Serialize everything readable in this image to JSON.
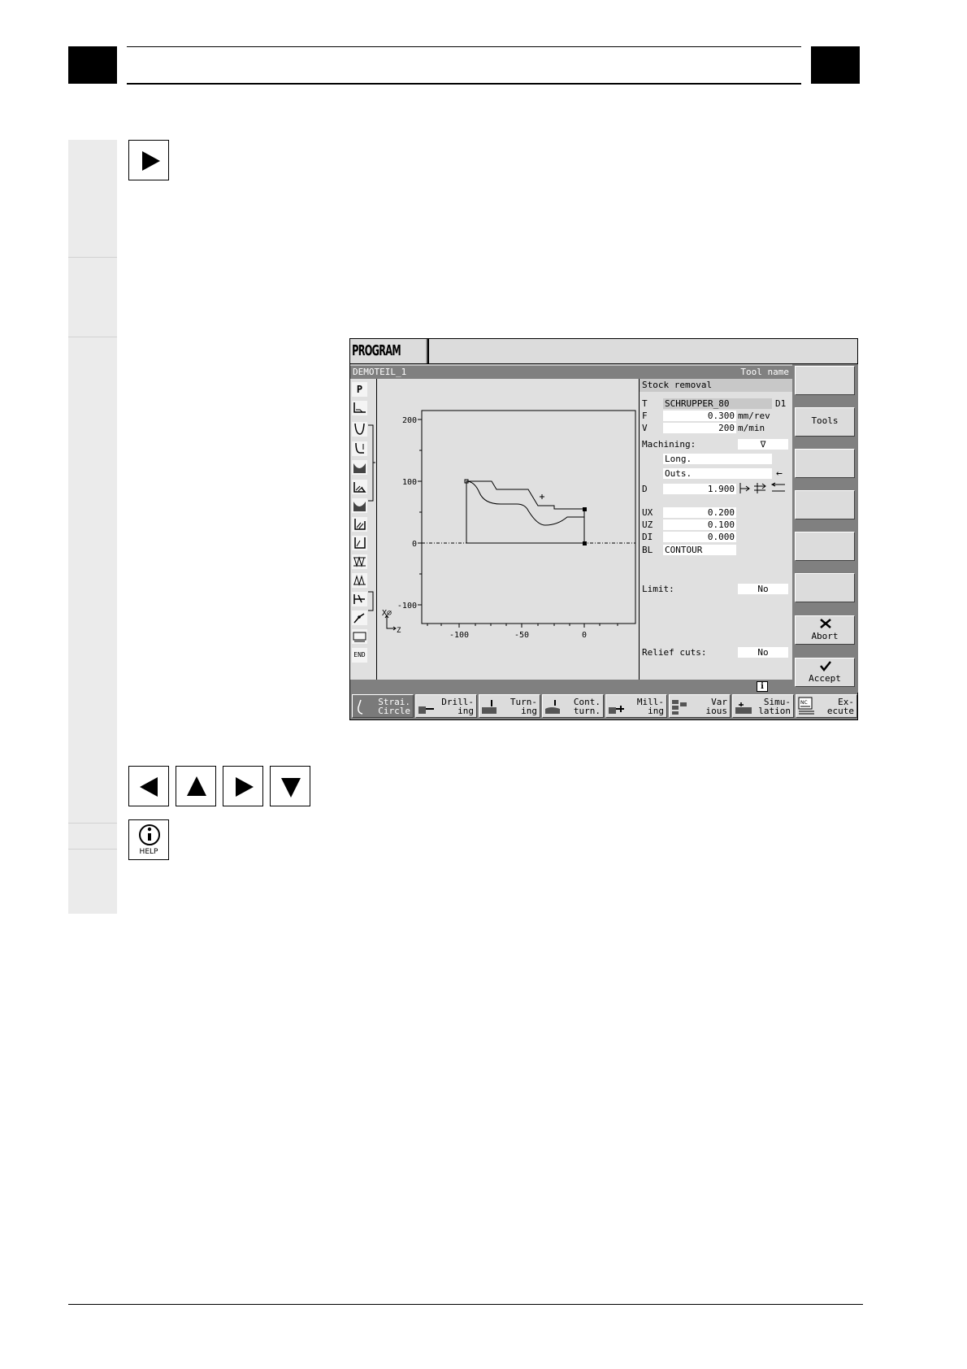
{
  "screen": {
    "mode": "PROGRAM",
    "program_name": "DEMOTEIL_1",
    "tool_name_label": "Tool name",
    "heading": "Stock removal",
    "params": {
      "T": {
        "label": "T",
        "value": "SCHRUPPER_80",
        "extra": "D1"
      },
      "F": {
        "label": "F",
        "value": "0.300",
        "unit": "mm/rev"
      },
      "V": {
        "label": "V",
        "value": "200",
        "unit": "m/min"
      },
      "machining_label": "Machining:",
      "machining_value": "∇",
      "direction": "Long.",
      "position": "Outs.",
      "position_arrow": "←",
      "D": {
        "label": "D",
        "value": "1.900"
      },
      "UX": {
        "label": "UX",
        "value": "0.200"
      },
      "UZ": {
        "label": "UZ",
        "value": "0.100"
      },
      "DI": {
        "label": "DI",
        "value": "0.000"
      },
      "BL": {
        "label": "BL",
        "value": "CONTOUR"
      },
      "limit_label": "Limit:",
      "limit_value": "No",
      "relief_label": "Relief cuts:",
      "relief_value": "No"
    },
    "plot": {
      "y_ticks": [
        "200",
        "100",
        "0",
        "-100"
      ],
      "x_ticks": [
        "-100",
        "-50",
        "0"
      ],
      "axis_x": "X∅",
      "axis_z": "Z"
    },
    "cycle_icons": [
      "P",
      "END"
    ],
    "vertical_softkeys": [
      "",
      "Tools",
      "",
      "",
      "",
      "",
      "Abort",
      "Accept"
    ],
    "horizontal_softkeys": [
      {
        "l1": "Strai.",
        "l2": "Circle"
      },
      {
        "l1": "Drill-",
        "l2": "ing"
      },
      {
        "l1": "Turn-",
        "l2": "ing"
      },
      {
        "l1": "Cont.",
        "l2": "turn."
      },
      {
        "l1": "Mill-",
        "l2": "ing"
      },
      {
        "l1": "Var",
        "l2": "ious"
      },
      {
        "l1": "Simu-",
        "l2": "lation"
      },
      {
        "l1": "Ex-",
        "l2": "ecute"
      }
    ],
    "info_icon": "i"
  },
  "help_key_label": "HELP"
}
